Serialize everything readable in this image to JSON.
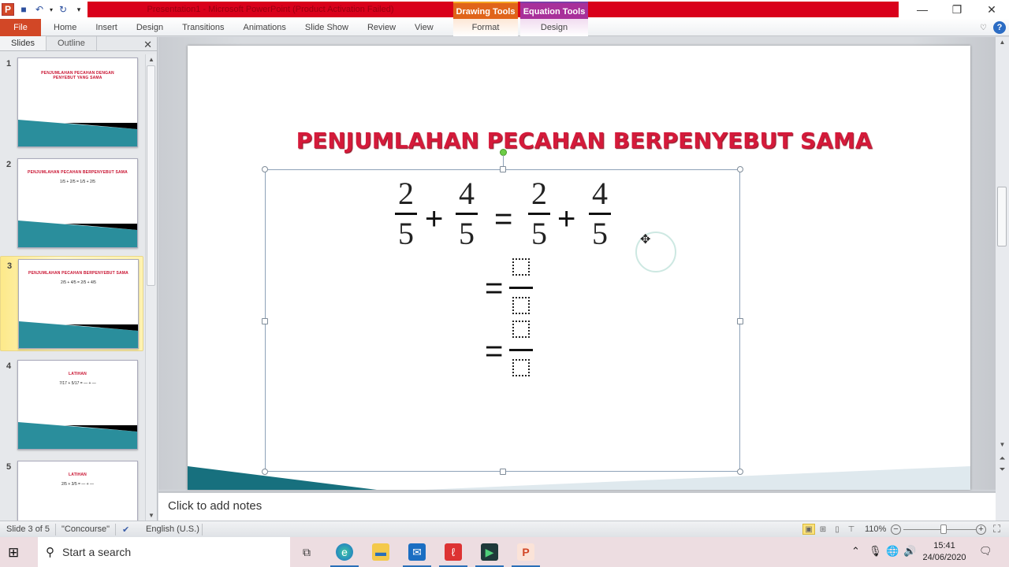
{
  "window": {
    "title": "Presentation1 - Microsoft PowerPoint (Product Activation Failed)",
    "contextual_tabs": [
      "Drawing Tools",
      "Equation Tools"
    ],
    "controls": {
      "minimize": "—",
      "restore": "❐",
      "close": "✕"
    }
  },
  "qat": {
    "app_icon": "P",
    "save": "💾",
    "undo": "↶",
    "redo": "↻",
    "customize": "▾"
  },
  "ribbon": {
    "tabs": [
      "File",
      "Home",
      "Insert",
      "Design",
      "Transitions",
      "Animations",
      "Slide Show",
      "Review",
      "View"
    ],
    "contextual": {
      "format": "Format",
      "design": "Design"
    },
    "minimize_icon": "♡",
    "help": "?"
  },
  "panel": {
    "tabs": [
      "Slides",
      "Outline"
    ],
    "close": "✕",
    "slides": [
      {
        "num": "1",
        "title": "PENJUMLAHAN PECAHAN DENGAN PENYEBUT YANG SAMA",
        "body": ""
      },
      {
        "num": "2",
        "title": "PENJUMLAHAN PECAHAN BERPENYEBUT SAMA",
        "body": "1/5 + 2/5 = 1/5 + 2/5"
      },
      {
        "num": "3",
        "title": "PENJUMLAHAN PECAHAN BERPENYEBUT SAMA",
        "body": "2/5 + 4/5 = 2/5 + 4/5"
      },
      {
        "num": "4",
        "title": "LATIHAN",
        "body": "7/17 + 5/17 = — + —"
      },
      {
        "num": "5",
        "title": "LATIHAN",
        "body": "2/5 + 3/5 = — + —"
      }
    ]
  },
  "slide": {
    "title": "PENJUMLAHAN PECAHAN BERPENYEBUT SAMA",
    "equation": {
      "f1": {
        "num": "2",
        "den": "5"
      },
      "f2": {
        "num": "4",
        "den": "5"
      },
      "f3": {
        "num": "2",
        "den": "5"
      },
      "f4": {
        "num": "4",
        "den": "5"
      },
      "plus": "+",
      "equals": "="
    }
  },
  "notes": {
    "placeholder": "Click to add notes"
  },
  "status": {
    "slide_info": "Slide 3 of 5",
    "theme": "\"Concourse\"",
    "language": "English (U.S.)",
    "zoom": "110%",
    "zoom_fraction": 0.55
  },
  "taskbar": {
    "search_placeholder": "Start a search",
    "time": "15:41",
    "date": "24/06/2020"
  },
  "colors": {
    "title_red": "#d41a3a",
    "app_red": "#d9001b",
    "file_tab": "#d24726",
    "drawing_tools": "#e0641a",
    "equation_tools": "#a8309a",
    "teal": "#1b7d8c"
  }
}
